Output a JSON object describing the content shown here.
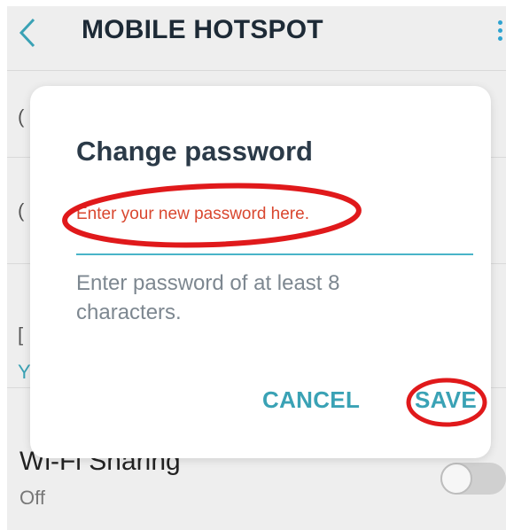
{
  "header": {
    "title": "MOBILE HOTSPOT",
    "back_icon": "chevron-left-icon",
    "more_icon": "more-vert-icon"
  },
  "background": {
    "clipped_letters": [
      "(",
      "(",
      "[",
      "Y"
    ],
    "wifi_sharing": {
      "title": "Wi-Fi Sharing",
      "status": "Off",
      "enabled": false
    }
  },
  "dialog": {
    "title": "Change password",
    "password_field": {
      "value": "",
      "placeholder": "Enter your new password here."
    },
    "hint": "Enter password of at least 8 characters.",
    "cancel_label": "CANCEL",
    "save_label": "SAVE"
  },
  "colors": {
    "accent": "#3aa2b5",
    "underline": "#49b4c8",
    "annotation_red": "#e0191b",
    "placeholder_red": "#d9472f",
    "title_text": "#2b3a48",
    "background": "#eeeeee"
  }
}
